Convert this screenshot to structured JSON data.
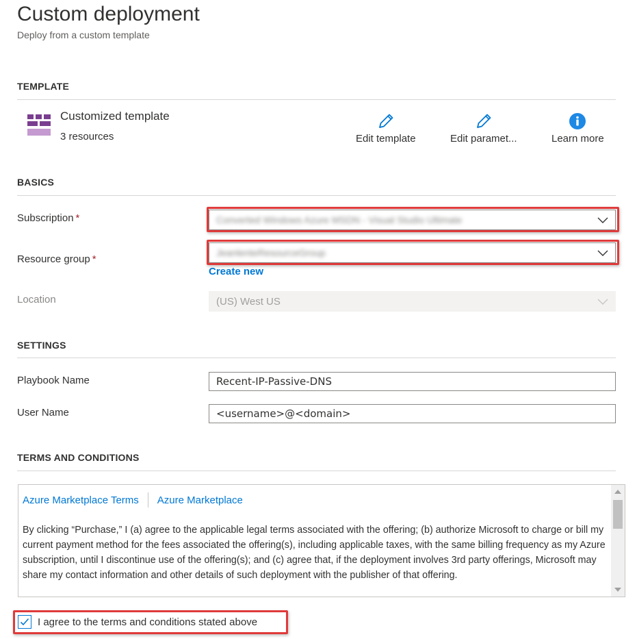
{
  "header": {
    "title": "Custom deployment",
    "subtitle": "Deploy from a custom template"
  },
  "template": {
    "section_title": "TEMPLATE",
    "name": "Customized template",
    "resources": "3 resources",
    "icon": "template-grid-icon",
    "actions": [
      {
        "label": "Edit template",
        "icon": "pencil-icon"
      },
      {
        "label": "Edit paramet...",
        "icon": "pencil-icon"
      },
      {
        "label": "Learn more",
        "icon": "info-icon"
      }
    ]
  },
  "basics": {
    "section_title": "BASICS",
    "subscription": {
      "label": "Subscription",
      "required_marker": "*",
      "value": "Converted Windows Azure MSDN - Visual Studio Ultimate"
    },
    "resource_group": {
      "label": "Resource group",
      "required_marker": "*",
      "value": "JeanlenteResourceGroup",
      "create_new": "Create new"
    },
    "location": {
      "label": "Location",
      "value": "(US) West US"
    }
  },
  "settings": {
    "section_title": "SETTINGS",
    "playbook_name": {
      "label": "Playbook Name",
      "value": "Recent-IP-Passive-DNS"
    },
    "user_name": {
      "label": "User Name",
      "value": "<username>@<domain>"
    }
  },
  "terms": {
    "section_title": "TERMS AND CONDITIONS",
    "link_terms": "Azure Marketplace Terms",
    "link_marketplace": "Azure Marketplace",
    "body": "By clicking “Purchase,” I (a) agree to the applicable legal terms associated with the offering; (b) authorize Microsoft to charge or bill my current payment method for the fees associated the offering(s), including applicable taxes, with the same billing frequency as my Azure subscription, until I discontinue use of the offering(s); and (c) agree that, if the deployment involves 3rd party offerings, Microsoft may share my contact information and other details of such deployment with the publisher of that offering.",
    "agree_label": "I agree to the terms and conditions stated above",
    "agree_checked": true
  },
  "colors": {
    "accent": "#0078d4",
    "highlight": "#e03a3a",
    "required": "#a4262c",
    "template_icon": "#8c4f9e"
  }
}
